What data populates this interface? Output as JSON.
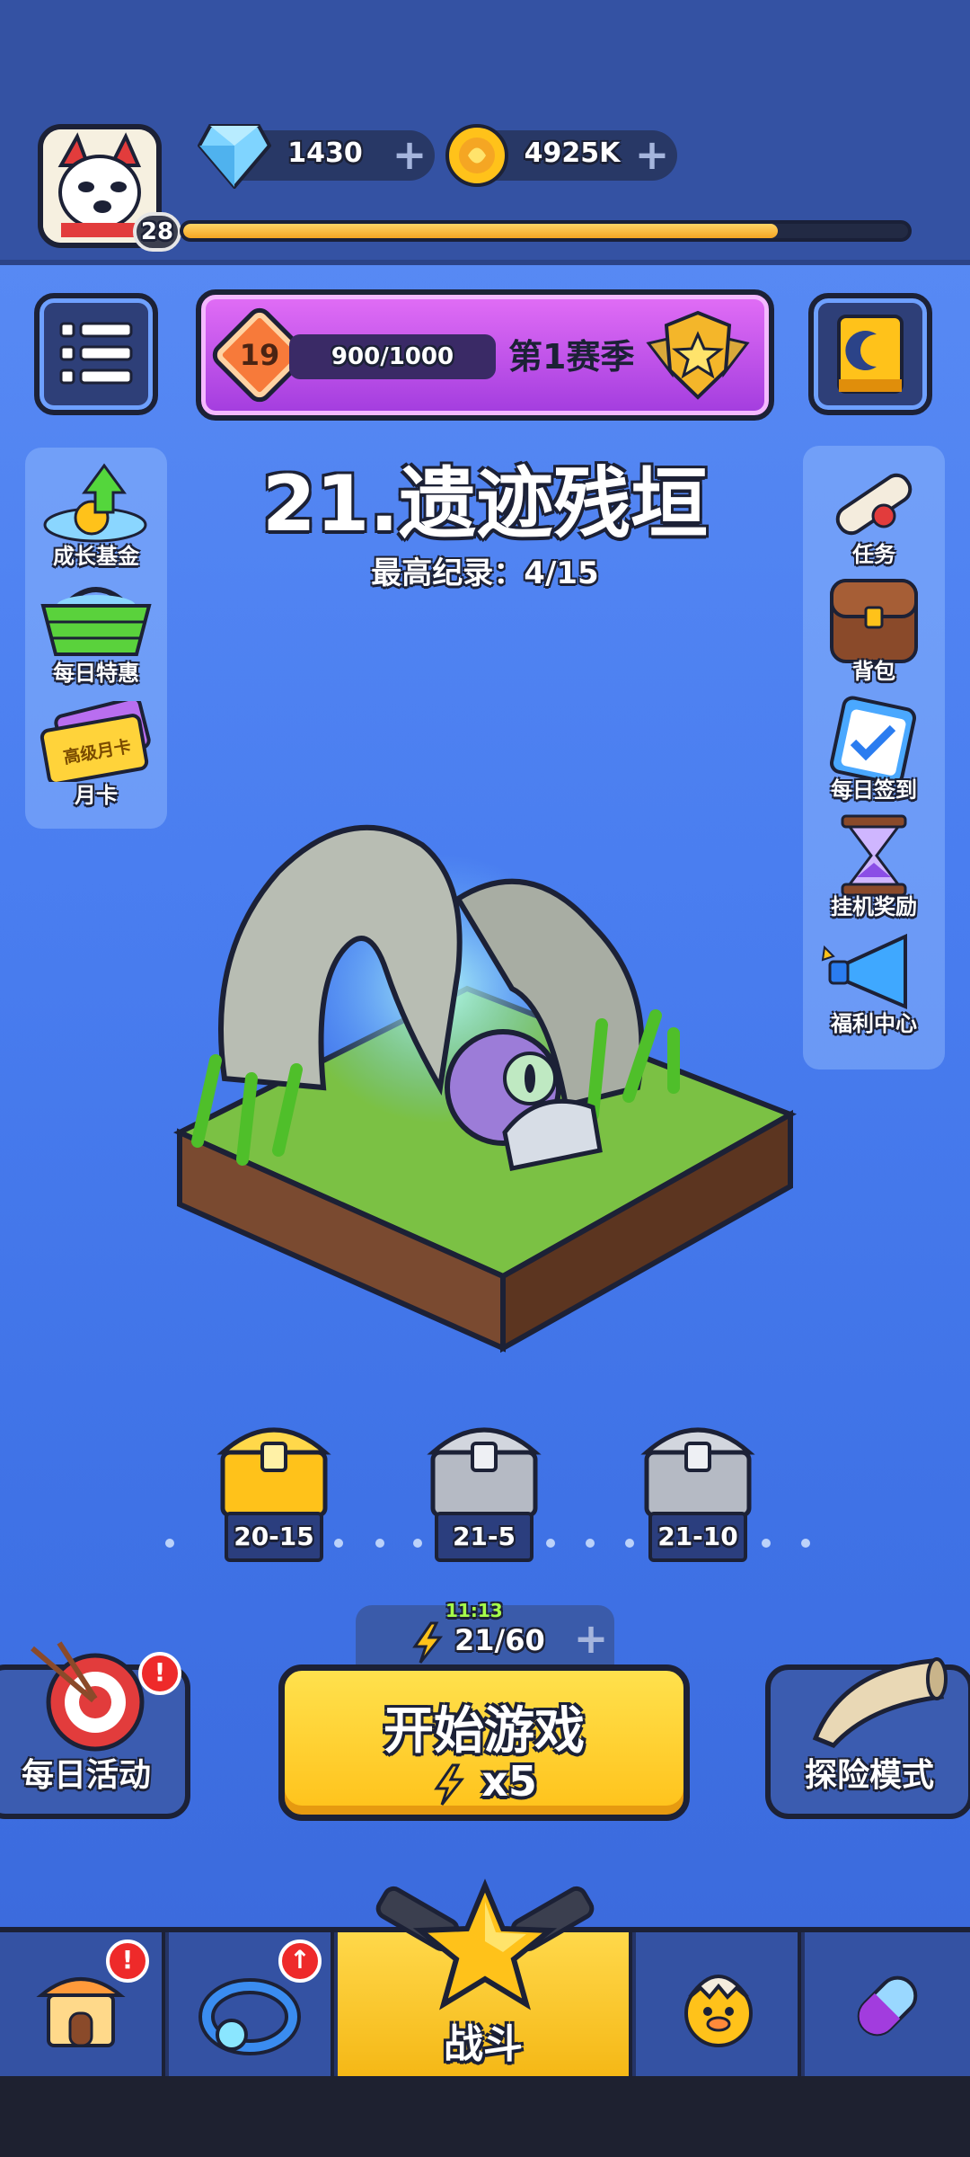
{
  "player": {
    "level": "28",
    "xp_fraction": 0.82
  },
  "currencies": {
    "gems": {
      "value": "1430",
      "icon": "gem-icon"
    },
    "coins": {
      "value": "4925K",
      "icon": "coin-icon"
    }
  },
  "season": {
    "level": "19",
    "progress_text": "900/1000",
    "name": "第1赛季"
  },
  "stage": {
    "title": "21.遗迹残垣",
    "best_record": "最高纪录：4/15"
  },
  "left_side": [
    {
      "label": "成长基金",
      "icon": "growth-fund-icon"
    },
    {
      "label": "每日特惠",
      "icon": "daily-deal-basket-icon"
    },
    {
      "label": "月卡",
      "icon": "monthly-card-icon",
      "card_text": "高级月卡"
    }
  ],
  "right_side": [
    {
      "label": "任务",
      "icon": "scroll-icon"
    },
    {
      "label": "背包",
      "icon": "backpack-icon"
    },
    {
      "label": "每日签到",
      "icon": "checkin-clipboard-icon"
    },
    {
      "label": "挂机奖励",
      "icon": "hourglass-icon"
    },
    {
      "label": "福利中心",
      "icon": "megaphone-icon"
    }
  ],
  "chests": [
    {
      "label": "20-15",
      "icon": "gold-chest-icon"
    },
    {
      "label": "21-5",
      "icon": "silver-chest-icon"
    },
    {
      "label": "21-10",
      "icon": "silver-chest-icon"
    }
  ],
  "energy": {
    "timer": "11:13",
    "value": "21/60"
  },
  "start_button": {
    "label": "开始游戏",
    "cost": "x5"
  },
  "daily_activity": {
    "label": "每日活动",
    "badge": "!"
  },
  "explore_mode": {
    "label": "探险模式"
  },
  "bottom_nav": [
    {
      "name": "shop",
      "icon": "shop-icon",
      "badge": "!"
    },
    {
      "name": "equipment",
      "icon": "ring-icon",
      "badge": "↑"
    },
    {
      "name": "battle",
      "label": "战斗",
      "icon": "star-cannon-icon"
    },
    {
      "name": "pets",
      "icon": "chick-egg-icon"
    },
    {
      "name": "items",
      "icon": "capsule-icon"
    }
  ],
  "colors": {
    "accent_yellow": "#ffc21a",
    "bg_blue": "#4a7ef0",
    "season_purple": "#c35af0"
  }
}
